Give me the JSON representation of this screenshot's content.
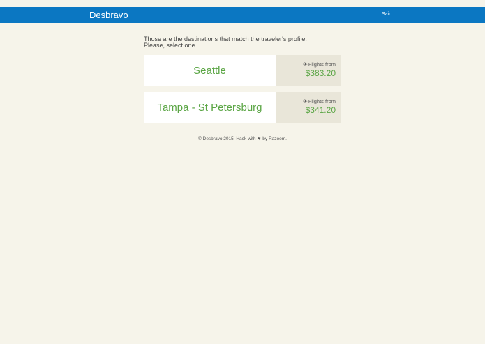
{
  "header": {
    "brand": "Desbravo",
    "logout_label": "Sair",
    "background_color": "#0b77c2"
  },
  "intro": {
    "line1": "Those are the destinations that match the traveler's profile.",
    "line2": "Please, select one"
  },
  "destinations": [
    {
      "name": "Seattle",
      "flights_label": "Flights from",
      "price": "$383.20",
      "icon": "plane-icon"
    },
    {
      "name": "Tampa - St Petersburg",
      "flights_label": "Flights from",
      "price": "$341.20",
      "icon": "plane-icon"
    }
  ],
  "footer": {
    "text_before": "© Desbravo 2015. Hack with",
    "icon": "heart-icon",
    "text_after": "by Razoom."
  },
  "colors": {
    "accent_green": "#5aa544",
    "page_background": "#f6f4ea"
  }
}
